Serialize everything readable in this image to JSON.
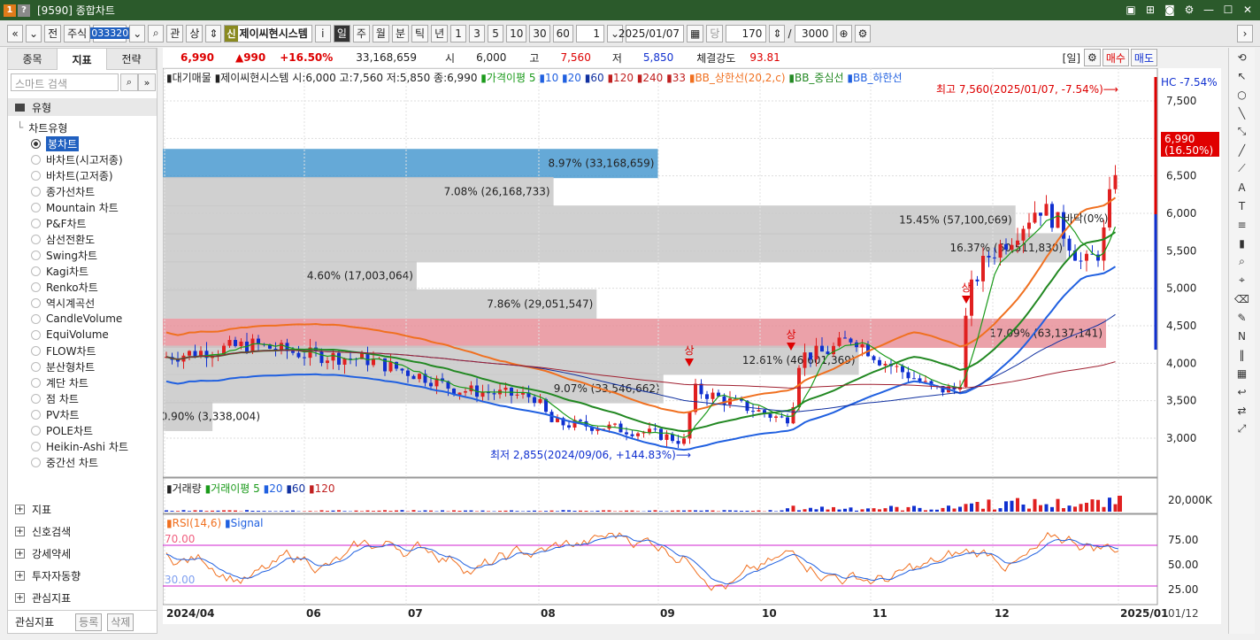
{
  "window": {
    "title": "[9590] 종합차트"
  },
  "toolbar": {
    "jeon": "전",
    "jusik": "주식",
    "code": "033320",
    "gwan": "관",
    "sang": "상",
    "sin": "신",
    "stock_name": "제이씨현시스템",
    "info": "i",
    "periods": [
      "일",
      "주",
      "월",
      "분",
      "틱",
      "년"
    ],
    "nums": [
      "1",
      "3",
      "5",
      "10",
      "30",
      "60"
    ],
    "count1": "1",
    "date": "2025/01/07",
    "dang": "당",
    "view_count": "170",
    "slash": "/",
    "total": "3000"
  },
  "left": {
    "tabs": [
      "종목",
      "지표",
      "전략"
    ],
    "search_placeholder": "스마트 검색",
    "section": "유형",
    "tree_root": "차트유형",
    "chart_types": [
      "봉차트",
      "바차트(시고저종)",
      "바차트(고저종)",
      "종가선차트",
      "Mountain 차트",
      "P&F차트",
      "삼선전환도",
      "Swing차트",
      "Kagi차트",
      "Renko차트",
      "역시계곡선",
      "CandleVolume",
      "EquiVolume",
      "FLOW차트",
      "분산형차트",
      "계단 차트",
      "점 차트",
      "PV차트",
      "POLE차트",
      "Heikin-Ashi 차트",
      "중간선 차트"
    ],
    "bottom_sections": [
      "지표",
      "신호검색",
      "강세약세",
      "투자자동향",
      "관심지표"
    ],
    "footer_label": "관심지표",
    "footer_add": "등록",
    "footer_del": "삭제"
  },
  "price": {
    "current": "6,990",
    "change": "▲990",
    "pct": "+16.50%",
    "volume": "33,168,659",
    "open_lbl": "시",
    "open": "6,000",
    "high_lbl": "고",
    "high": "7,560",
    "low_lbl": "저",
    "low": "5,850",
    "strength_lbl": "체결강도",
    "strength": "93.81",
    "il": "[일]",
    "buy": "매수",
    "sell": "매도"
  },
  "legend_main": {
    "title": "▮대기매물 ▮제이씨현시스템 시:6,000 고:7,560 저:5,850 종:6,990",
    "ma": "▮가격이평 5",
    "ma10": "▮10",
    "ma20": "▮20",
    "ma60": "▮60",
    "ma120": "▮120",
    "ma240": "▮240",
    "ma33": "▮33",
    "bb_up": "▮BB_상한선(20,2,c)",
    "bb_mid": "▮BB_중심선",
    "bb_low": "▮BB_하한선"
  },
  "annotations": {
    "high": "최고 7,560(2025/01/07, -7.54%)⟶",
    "low": "최저 2,855(2024/09/06, +144.83%)⟶",
    "hc": "HC  -7.54%",
    "price_tag": "6,990",
    "price_tag_pct": "(16.50%)",
    "sang": "상",
    "bottom_lbl": "바닥(0%)"
  },
  "supply_bars": [
    {
      "label": "8.97% (33,168,659)",
      "pct": 8.97,
      "highlight": "blue"
    },
    {
      "label": "7.08% (26,168,733)",
      "pct": 7.08,
      "highlight": "none"
    },
    {
      "label": "15.45% (57,100,069)",
      "pct": 15.45,
      "highlight": "none"
    },
    {
      "label": "16.37% (60,511,830)",
      "pct": 16.37,
      "highlight": "none"
    },
    {
      "label": "4.60% (17,003,064)",
      "pct": 4.6,
      "highlight": "none"
    },
    {
      "label": "7.86% (29,051,547)",
      "pct": 7.86,
      "highlight": "none"
    },
    {
      "label": "17.09% (63,137,141)",
      "pct": 17.09,
      "highlight": "red"
    },
    {
      "label": "12.61% (46,601,369)",
      "pct": 12.61,
      "highlight": "none"
    },
    {
      "label": "9.07% (33,546,662)",
      "pct": 9.07,
      "highlight": "none"
    },
    {
      "label": "0.90% (3,338,004)",
      "pct": 0.9,
      "highlight": "none"
    }
  ],
  "price_axis": [
    "7,500",
    "7,000",
    "6,500",
    "6,000",
    "5,500",
    "5,000",
    "4,500",
    "4,000",
    "3,500",
    "3,000"
  ],
  "volume_panel": {
    "title": "▮거래량",
    "ma": "▮거래이평 5",
    "ma20": "▮20",
    "ma60": "▮60",
    "ma120": "▮120",
    "axis": "20,000K"
  },
  "rsi_panel": {
    "title": "▮RSI(14,6)",
    "signal": "▮Signal",
    "lvl70": "70.00",
    "lvl30": "30.00",
    "axis": [
      "75.00",
      "50.00",
      "25.00"
    ]
  },
  "x_axis": [
    "2024/04",
    "06",
    "07",
    "08",
    "09",
    "10",
    "11",
    "12",
    "2025/01"
  ],
  "x_axis_right": "01/12",
  "colors": {
    "up": "#e02020",
    "down": "#1030d0",
    "ma5": "#1a9a1a",
    "bb": "#f07020",
    "bbmid": "#228822",
    "bblow": "#2060e0"
  }
}
